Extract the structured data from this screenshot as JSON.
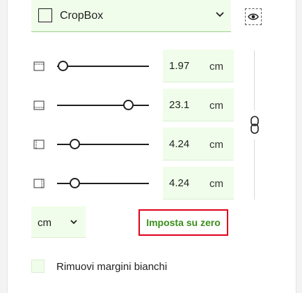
{
  "box_select": {
    "value": "CropBox",
    "icon": "chevron-down-icon"
  },
  "visibility_icon": "eye-icon",
  "margins": [
    {
      "name": "top",
      "icon": "margin-top-icon",
      "value": "1.97",
      "unit": "cm",
      "slider_fraction": 0.06
    },
    {
      "name": "bottom",
      "icon": "margin-bottom-icon",
      "value": "23.1",
      "unit": "cm",
      "slider_fraction": 0.77
    },
    {
      "name": "left",
      "icon": "margin-left-icon",
      "value": "4.24",
      "unit": "cm",
      "slider_fraction": 0.19
    },
    {
      "name": "right",
      "icon": "margin-right-icon",
      "value": "4.24",
      "unit": "cm",
      "slider_fraction": 0.19
    }
  ],
  "link_icon": "chain-link-icon",
  "unit_select": {
    "value": "cm"
  },
  "reset_button": {
    "label": "Imposta su zero"
  },
  "remove_white_margins": {
    "label": "Rimuovi margini bianchi",
    "checked": false
  },
  "colors": {
    "field_bg": "#f0fdea",
    "accent_text": "#3a8f1b",
    "highlight_border": "#e0001b"
  }
}
